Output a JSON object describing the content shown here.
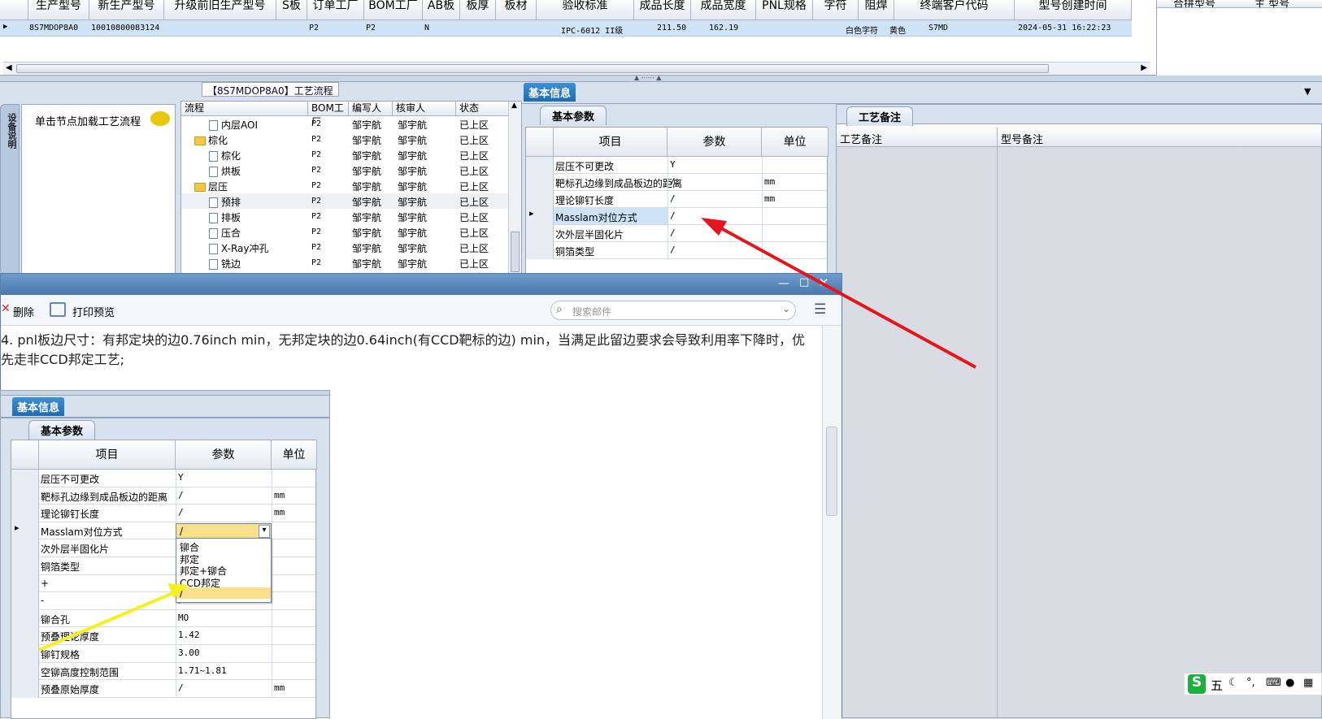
{
  "top_grid": {
    "headers": [
      "生产型号",
      "新生产型号",
      "升级前旧生产型号",
      "S板",
      "订单工厂",
      "BOM工厂",
      "AB板",
      "板厚",
      "板材",
      "验收标准",
      "成品长度",
      "成品宽度",
      "PNL规格",
      "字符",
      "阻焊",
      "终端客户代码",
      "型号创建时间"
    ],
    "row": [
      "8S7MDOP8A0",
      "10010800083124",
      "",
      "",
      "P2",
      "P2",
      "N",
      "",
      "",
      "IPC-6012 II级",
      "211.50",
      "162.19",
      "",
      "白色字符",
      "黄色",
      "S7MD",
      "2024-05-31 16:22:23"
    ],
    "right_headers": [
      "合拼型号",
      "主 型号"
    ]
  },
  "left_side_tab": "设备说明",
  "note_panel": {
    "label": "单击节点加载工艺流程"
  },
  "tree": {
    "title": "【8S7MDOP8A0】工艺流程",
    "headers": [
      "流程",
      "BOM工厂",
      "编写人",
      "核审人",
      "状态"
    ],
    "rows": [
      {
        "name": "内层AOI",
        "type": "doc",
        "indent": 2,
        "bom": "P2",
        "writer": "邹宇航",
        "reviewer": "邹宇航",
        "status": "已上区"
      },
      {
        "name": "棕化",
        "type": "folder",
        "indent": 1,
        "bom": "P2",
        "writer": "邹宇航",
        "reviewer": "邹宇航",
        "status": "已上区"
      },
      {
        "name": "棕化",
        "type": "doc",
        "indent": 2,
        "bom": "P2",
        "writer": "邹宇航",
        "reviewer": "邹宇航",
        "status": "已上区"
      },
      {
        "name": "烘板",
        "type": "doc",
        "indent": 2,
        "bom": "P2",
        "writer": "邹宇航",
        "reviewer": "邹宇航",
        "status": "已上区"
      },
      {
        "name": "层压",
        "type": "folder",
        "indent": 1,
        "bom": "P2",
        "writer": "邹宇航",
        "reviewer": "邹宇航",
        "status": "已上区"
      },
      {
        "name": "预排",
        "type": "doc",
        "indent": 2,
        "bom": "P2",
        "writer": "邹宇航",
        "reviewer": "邹宇航",
        "status": "已上区"
      },
      {
        "name": "排板",
        "type": "doc",
        "indent": 2,
        "bom": "P2",
        "writer": "邹宇航",
        "reviewer": "邹宇航",
        "status": "已上区"
      },
      {
        "name": "压合",
        "type": "doc",
        "indent": 2,
        "bom": "P2",
        "writer": "邹宇航",
        "reviewer": "邹宇航",
        "status": "已上区"
      },
      {
        "name": "X-Ray冲孔",
        "type": "doc",
        "indent": 2,
        "bom": "P2",
        "writer": "邹宇航",
        "reviewer": "邹宇航",
        "status": "已上区"
      },
      {
        "name": "铣边",
        "type": "doc",
        "indent": 2,
        "bom": "P2",
        "writer": "邹宇航",
        "reviewer": "邹宇航",
        "status": "已上区"
      }
    ]
  },
  "basic_info": {
    "tab": "基本信息",
    "subtab": "基本参数",
    "headers": [
      "项目",
      "参数",
      "单位"
    ],
    "rows": [
      {
        "item": "层压不可更改",
        "param": "Y",
        "unit": ""
      },
      {
        "item": "靶标孔边缘到成品板边的距离",
        "param": "/",
        "unit": "mm"
      },
      {
        "item": "理论铆钉长度",
        "param": "/",
        "unit": "mm"
      },
      {
        "item": "Masslam对位方式",
        "param": "/",
        "unit": ""
      },
      {
        "item": "次外层半固化片",
        "param": "/",
        "unit": ""
      },
      {
        "item": "铜箔类型",
        "param": "/",
        "unit": ""
      }
    ]
  },
  "remarks": {
    "tab": "工艺备注",
    "col1": "工艺备注",
    "col2": "型号备注"
  },
  "mail": {
    "toolbar": {
      "delete": "删除",
      "print_preview": "打印预览"
    },
    "search_placeholder": "搜索邮件",
    "paragraph": "4. pnl板边尺寸：有邦定块的边0.76inch min，无邦定块的边0.64inch(有CCD靶标的边) min，当满足此留边要求会导致利用率下降时，优先走非CCD邦定工艺;"
  },
  "embedded": {
    "tab": "基本信息",
    "subtab": "基本参数",
    "headers": [
      "项目",
      "参数",
      "单位"
    ],
    "rows": [
      {
        "item": "层压不可更改",
        "param": "Y",
        "unit": ""
      },
      {
        "item": "靶标孔边缘到成品板边的距离",
        "param": "/",
        "unit": "mm"
      },
      {
        "item": "理论铆钉长度",
        "param": "/",
        "unit": "mm"
      },
      {
        "item": "Masslam对位方式",
        "param": "/",
        "unit": ""
      },
      {
        "item": "次外层半固化片",
        "param": "",
        "unit": ""
      },
      {
        "item": "铜箔类型",
        "param": "",
        "unit": ""
      },
      {
        "item": "+",
        "param": "",
        "unit": ""
      },
      {
        "item": "-",
        "param": "/",
        "unit": ""
      },
      {
        "item": "铆合孔",
        "param": "MO",
        "unit": ""
      },
      {
        "item": "预叠理论厚度",
        "param": "1.42",
        "unit": ""
      },
      {
        "item": "铆钉规格",
        "param": "3.00",
        "unit": ""
      },
      {
        "item": "空铆高度控制范围",
        "param": "1.71~1.81",
        "unit": ""
      },
      {
        "item": "预叠原始厚度",
        "param": "/",
        "unit": "mm"
      }
    ],
    "dropdown_value": "/",
    "dropdown_options": [
      "铆合",
      "邦定",
      "邦定+铆合",
      "CCD邦定",
      "/"
    ]
  },
  "ime": {
    "logo": "S",
    "mode": "五"
  },
  "colors": {
    "arrow_red": "#e8131b",
    "arrow_yellow": "#f5f020",
    "tab_blue": "#2a79c2"
  }
}
